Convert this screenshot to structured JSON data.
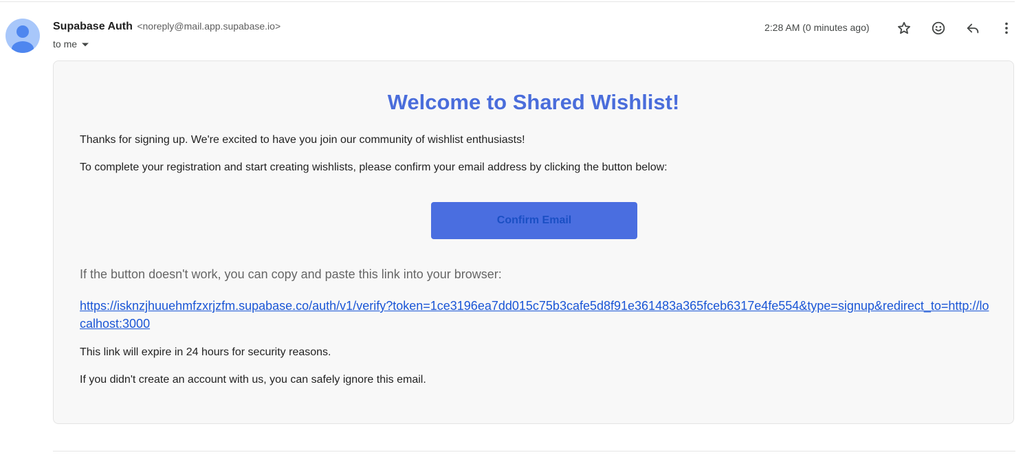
{
  "header": {
    "sender_name": "Supabase Auth",
    "sender_email": "<noreply@mail.app.supabase.io>",
    "recipient": "to me",
    "timestamp": "2:28 AM (0 minutes ago)",
    "icons": [
      "star-icon",
      "emoji-icon",
      "reply-icon",
      "more-vert-icon"
    ]
  },
  "email": {
    "heading": "Welcome to Shared Wishlist!",
    "intro": "Thanks for signing up. We're excited to have you join our community of wishlist enthusiasts!",
    "instruction": "To complete your registration and start creating wishlists, please confirm your email address by clicking the button below:",
    "button_label": "Confirm Email",
    "fallback_text": "If the button doesn't work, you can copy and paste this link into your browser:",
    "verify_link": "https://isknzjhuuehmfzxrjzfm.supabase.co/auth/v1/verify?token=1ce3196ea7dd015c75b3cafe5d8f91e361483a365fceb6317e4fe554&type=signup&redirect_to=http://localhost:3000",
    "expiry_note": "This link will expire in 24 hours for security reasons.",
    "ignore_note": "If you didn't create an account with us, you can safely ignore this email."
  },
  "colors": {
    "heading": "#4a6ddb",
    "button_bg": "#4a6ee0",
    "button_text": "#1a4fc4",
    "link": "#1a56d6",
    "avatar_bg": "#a8c7fa",
    "avatar_fg": "#4285f4"
  }
}
